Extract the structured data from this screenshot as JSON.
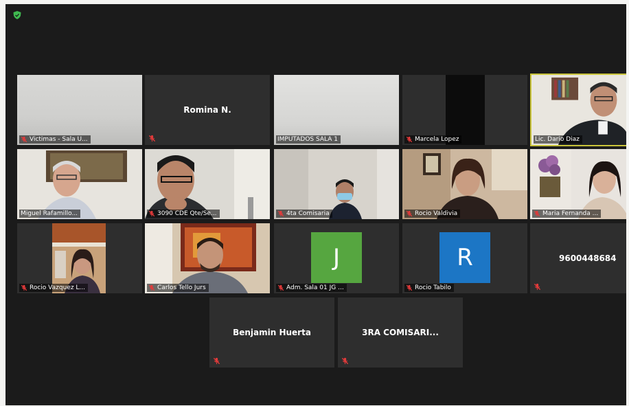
{
  "colors": {
    "window_bg": "#1b1b1b",
    "tile_bg": "#2e2e2e",
    "muted_icon": "#e23a3a",
    "secure_icon": "#3fb950",
    "avatar_j": "#56a640",
    "avatar_r": "#1c76c5"
  },
  "participants": [
    {
      "label": "Victimas - Sala U...",
      "muted": true,
      "video": true
    },
    {
      "name": "Romina N.",
      "muted": true,
      "video": false
    },
    {
      "label": "IMPUTADOS SALA 1",
      "muted": false,
      "video": true
    },
    {
      "label": "Marcela Lopez",
      "muted": true,
      "video": true
    },
    {
      "label": "Lic. Dario Diaz",
      "muted": false,
      "video": true
    },
    {
      "label": "Miguel Rafamillo...",
      "muted": false,
      "video": true
    },
    {
      "label": "3090 CDE Qte/Se...",
      "muted": true,
      "video": true
    },
    {
      "label": "4ta Comisaria",
      "muted": true,
      "video": true
    },
    {
      "label": "Rocio Valdivia",
      "muted": true,
      "video": true
    },
    {
      "label": "Maria Fernanda ...",
      "muted": true,
      "video": true
    },
    {
      "label": "Rocio Vazquez L...",
      "muted": true,
      "video": true
    },
    {
      "label": "Carlos Tello Jurs",
      "muted": true,
      "video": true
    },
    {
      "label": "Adm. Sala 01 JG ...",
      "muted": true,
      "video": false,
      "avatar_letter": "J"
    },
    {
      "label": "Rocio Tabilo",
      "muted": true,
      "video": false,
      "avatar_letter": "R"
    },
    {
      "name": "9600448684",
      "muted": true,
      "video": false
    },
    {
      "name": "Benjamin Huerta",
      "muted": true,
      "video": false
    },
    {
      "name": "3RA COMISARI...",
      "muted": true,
      "video": false
    }
  ]
}
